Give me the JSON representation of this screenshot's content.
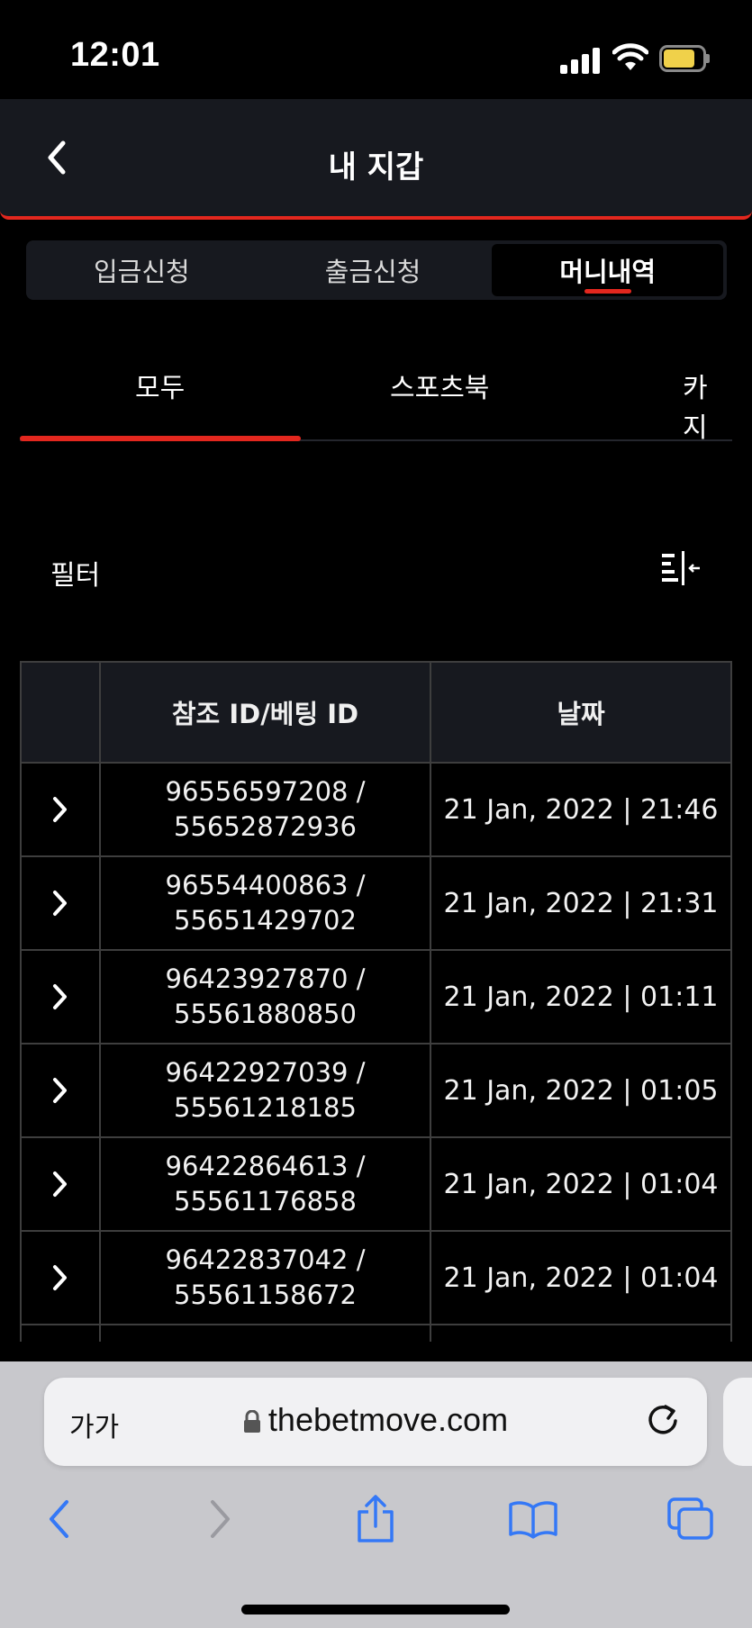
{
  "status": {
    "time": "12:01"
  },
  "header": {
    "title": "내 지갑"
  },
  "top_tabs": [
    "입금신청",
    "출금신청",
    "머니내역"
  ],
  "top_tab_active": "머니내역",
  "category_tabs": [
    "모두",
    "스포츠북",
    "카지"
  ],
  "category_active": "모두",
  "filter": {
    "label": "필터"
  },
  "table": {
    "headers": [
      "",
      "참조 ID/베팅 ID",
      "날짜"
    ],
    "rows": [
      {
        "ref": "96556597208 /",
        "bet": "55652872936",
        "date": "21 Jan, 2022 | 21:46"
      },
      {
        "ref": "96554400863 /",
        "bet": "55651429702",
        "date": "21 Jan, 2022 | 21:31"
      },
      {
        "ref": "96423927870 /",
        "bet": "55561880850",
        "date": "21 Jan, 2022 | 01:11"
      },
      {
        "ref": "96422927039 /",
        "bet": "55561218185",
        "date": "21 Jan, 2022 | 01:05"
      },
      {
        "ref": "96422864613 /",
        "bet": "55561176858",
        "date": "21 Jan, 2022 | 01:04"
      },
      {
        "ref": "96422837042 /",
        "bet": "55561158672",
        "date": "21 Jan, 2022 | 01:04"
      }
    ]
  },
  "browser": {
    "text_size_label": "가가",
    "url": "thebetmove.com"
  },
  "colors": {
    "accent": "#e3271e",
    "header_bg": "#17191f",
    "ios_blue": "#3478f6"
  },
  "icons": [
    "chevron-left-icon",
    "chevron-right-icon",
    "filter-icon",
    "lock-icon",
    "reload-icon",
    "share-icon",
    "bookmarks-icon",
    "tabs-icon"
  ]
}
